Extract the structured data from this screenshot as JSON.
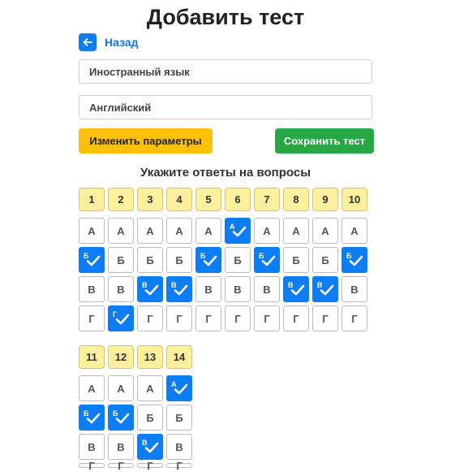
{
  "page": {
    "title": "Добавить тест"
  },
  "back": {
    "label": "Назад",
    "icon": "arrow-left-icon"
  },
  "form": {
    "subject": "Иностранный язык",
    "language": "Английский"
  },
  "buttons": {
    "change_params": "Изменить параметры",
    "save_test": "Сохранить тест"
  },
  "colors": {
    "accent": "#0d7df5",
    "warning": "#ffc107",
    "success": "#28a745",
    "question_number_bg": "#fcef9e"
  },
  "answers": {
    "heading": "Укажите ответы на вопросы",
    "options": [
      "А",
      "Б",
      "В",
      "Г"
    ],
    "questions": [
      {
        "number": "1",
        "selected": [
          "Б"
        ]
      },
      {
        "number": "2",
        "selected": [
          "Г"
        ]
      },
      {
        "number": "3",
        "selected": [
          "В"
        ]
      },
      {
        "number": "4",
        "selected": [
          "В"
        ]
      },
      {
        "number": "5",
        "selected": [
          "Б"
        ]
      },
      {
        "number": "6",
        "selected": [
          "А"
        ]
      },
      {
        "number": "7",
        "selected": [
          "Б"
        ]
      },
      {
        "number": "8",
        "selected": [
          "В"
        ]
      },
      {
        "number": "9",
        "selected": [
          "В"
        ]
      },
      {
        "number": "10",
        "selected": [
          "Б"
        ]
      },
      {
        "number": "11",
        "selected": [
          "Б"
        ]
      },
      {
        "number": "12",
        "selected": [
          "Б"
        ]
      },
      {
        "number": "13",
        "selected": [
          "В"
        ]
      },
      {
        "number": "14",
        "selected": [
          "А"
        ]
      }
    ]
  }
}
